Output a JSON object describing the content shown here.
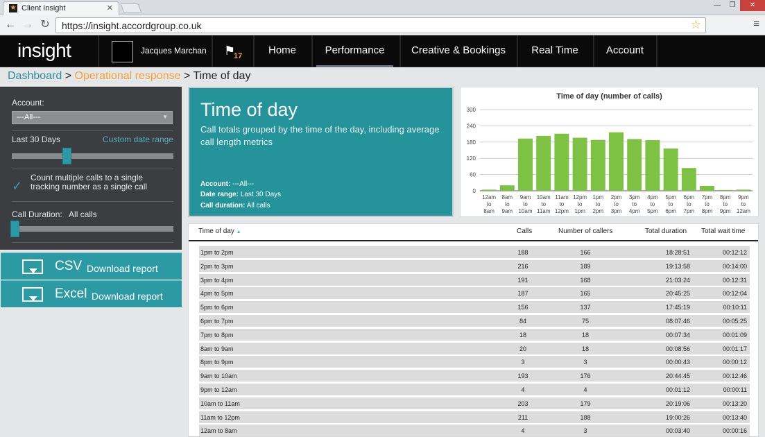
{
  "browser": {
    "tab_title": "Client Insight",
    "url": "https://insight.accordgroup.co.uk"
  },
  "header": {
    "logo": "insight",
    "user_name": "Jacques Marchan",
    "notification_count": "17",
    "nav": [
      "Home",
      "Performance",
      "Creative & Bookings",
      "Real Time",
      "Account"
    ],
    "active_nav": "Performance"
  },
  "breadcrumb": {
    "crumb1": "Dashboard",
    "sep1": " > ",
    "crumb2": "Operational response",
    "sep2": " > ",
    "current": "Time of day"
  },
  "sidebar": {
    "account_label": "Account:",
    "account_value": "---All---",
    "period_label": "Last 30 Days",
    "custom_range_link": "Custom date range",
    "period_slider_fraction": 0.33,
    "count_multiple_label": "Count multiple calls to a single tracking number as a single call",
    "count_multiple_checked": true,
    "duration_label": "Call Duration:",
    "duration_value": "All calls",
    "duration_slider_fraction": 0.0,
    "csv": {
      "title": "CSV",
      "sub": "Download report"
    },
    "excel": {
      "title": "Excel",
      "sub": "Download report"
    }
  },
  "info": {
    "title": "Time of day",
    "description": "Call totals grouped by the time of the day, including average call length metrics",
    "account_label": "Account:",
    "account_value": "---All---",
    "range_label": "Date range:",
    "range_value": "Last 30 Days",
    "duration_label": "Call duration:",
    "duration_value": "All calls"
  },
  "chart_data": {
    "type": "bar",
    "title": "Time of day (number of calls)",
    "categories": [
      "12am to 8am",
      "8am to 9am",
      "9am to 10am",
      "10am to 11am",
      "11am to 12pm",
      "12pm to 1pm",
      "1pm to 2pm",
      "2pm to 3pm",
      "3pm to 4pm",
      "4pm to 5pm",
      "5pm to 6pm",
      "6pm to 7pm",
      "7pm to 8pm",
      "8pm to 9pm",
      "9pm to 12am"
    ],
    "category_lines": [
      [
        "12am",
        "to",
        "8am"
      ],
      [
        "8am",
        "to",
        "9am"
      ],
      [
        "9am",
        "to",
        "10am"
      ],
      [
        "10am",
        "to",
        "11am"
      ],
      [
        "11am",
        "to",
        "12pm"
      ],
      [
        "12pm",
        "to",
        "1pm"
      ],
      [
        "1pm",
        "to",
        "2pm"
      ],
      [
        "2pm",
        "to",
        "3pm"
      ],
      [
        "3pm",
        "to",
        "4pm"
      ],
      [
        "4pm",
        "to",
        "5pm"
      ],
      [
        "5pm",
        "to",
        "6pm"
      ],
      [
        "6pm",
        "to",
        "7pm"
      ],
      [
        "7pm",
        "to",
        "8pm"
      ],
      [
        "8pm",
        "to",
        "9pm"
      ],
      [
        "9pm",
        "to",
        "12am"
      ]
    ],
    "values": [
      4,
      20,
      193,
      203,
      211,
      196,
      188,
      216,
      191,
      187,
      156,
      84,
      18,
      3,
      4
    ],
    "yticks": [
      0,
      60,
      120,
      180,
      240,
      300
    ],
    "ylim": [
      0,
      300
    ],
    "grid": true,
    "bar_color": "#7dc242"
  },
  "table": {
    "headers": {
      "time": "Time of day",
      "sort_indicator": "▲",
      "calls": "Calls",
      "callers": "Number of callers",
      "duration": "Total duration",
      "wait": "Total wait time"
    },
    "rows": [
      {
        "time": "1pm to 2pm",
        "calls": "188",
        "callers": "166",
        "duration": "18:28:51",
        "wait": "00:12:12"
      },
      {
        "time": "2pm to 3pm",
        "calls": "216",
        "callers": "189",
        "duration": "19:13:58",
        "wait": "00:14:00"
      },
      {
        "time": "3pm to 4pm",
        "calls": "191",
        "callers": "168",
        "duration": "21:03:24",
        "wait": "00:12:31"
      },
      {
        "time": "4pm to 5pm",
        "calls": "187",
        "callers": "165",
        "duration": "20:45:25",
        "wait": "00:12:04"
      },
      {
        "time": "5pm to 6pm",
        "calls": "156",
        "callers": "137",
        "duration": "17:45:19",
        "wait": "00:10:11"
      },
      {
        "time": "6pm to 7pm",
        "calls": "84",
        "callers": "75",
        "duration": "08:07:46",
        "wait": "00:05:25"
      },
      {
        "time": "7pm to 8pm",
        "calls": "18",
        "callers": "18",
        "duration": "00:07:34",
        "wait": "00:01:09"
      },
      {
        "time": "8am to 9am",
        "calls": "20",
        "callers": "18",
        "duration": "00:08:56",
        "wait": "00:01:17"
      },
      {
        "time": "8pm to 9pm",
        "calls": "3",
        "callers": "3",
        "duration": "00:00:43",
        "wait": "00:00:12"
      },
      {
        "time": "9am to 10am",
        "calls": "193",
        "callers": "176",
        "duration": "20:44:45",
        "wait": "00:12:46"
      },
      {
        "time": "9pm to 12am",
        "calls": "4",
        "callers": "4",
        "duration": "00:01:12",
        "wait": "00:00:11"
      },
      {
        "time": "10am to 11am",
        "calls": "203",
        "callers": "179",
        "duration": "20:19:06",
        "wait": "00:13:20"
      },
      {
        "time": "11am to 12pm",
        "calls": "211",
        "callers": "188",
        "duration": "19:00:26",
        "wait": "00:13:40"
      },
      {
        "time": "12am to 8am",
        "calls": "4",
        "callers": "3",
        "duration": "00:03:40",
        "wait": "00:00:16"
      }
    ]
  }
}
